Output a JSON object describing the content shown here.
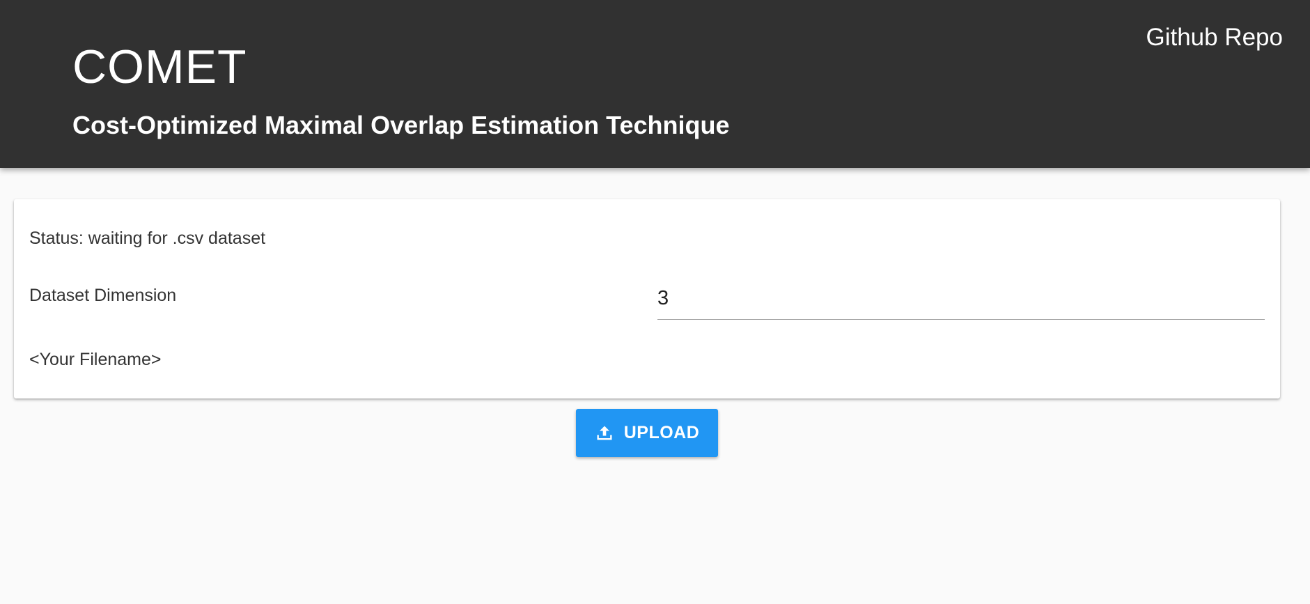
{
  "header": {
    "title": "COMET",
    "subtitle": "Cost-Optimized Maximal Overlap Estimation Technique",
    "repo_link": "Github Repo"
  },
  "card": {
    "status": "Status: waiting for .csv dataset",
    "dimension_label": "Dataset Dimension",
    "dimension_value": "3",
    "filename": "<Your Filename>"
  },
  "upload": {
    "label": "UPLOAD",
    "icon": "upload-icon"
  },
  "colors": {
    "header_bg": "#313131",
    "accent": "#2196f3",
    "page_bg": "#fafafa"
  }
}
